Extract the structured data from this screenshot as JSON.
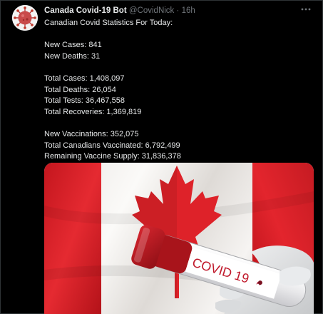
{
  "tweet": {
    "author_name": "Canada Covid-19 Bot",
    "handle": "@CovidNick",
    "separator": "·",
    "time": "16h",
    "more_icon": "more-icon",
    "body_lines": [
      "Canadian Covid Statistics For Today:",
      "",
      "New Cases: 841",
      "New Deaths: 31",
      "",
      "Total Cases: 1,408,097",
      "Total Deaths: 26,054",
      "Total Tests: 36,467,558",
      "Total Recoveries: 1,369,819",
      "",
      "New Vaccinations: 352,075",
      "Total Canadians Vaccinated: 6,792,499",
      "Remaining Vaccine Supply: 31,836,378"
    ],
    "media": {
      "tube_label": "COVID 19",
      "flag_red": "#e0242c",
      "flag_white": "#f4f2f0"
    }
  }
}
